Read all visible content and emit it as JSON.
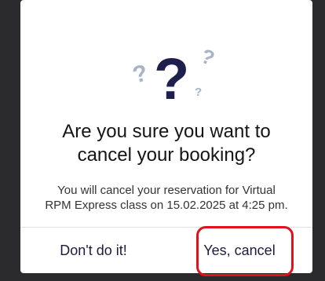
{
  "dialog": {
    "illustration_icon": "question-marks-icon",
    "title_line1": "Are you sure you want to",
    "title_line2": "cancel your booking?",
    "message_line1": "You will cancel your reservation for Virtual",
    "message_line2": "RPM Express class on 15.02.2025 at 4:25 pm.",
    "cancel_button_label": "Don't do it!",
    "confirm_button_label": "Yes, cancel"
  },
  "colors": {
    "dialog_background": "#ffffff",
    "backdrop": "#2b2b2d",
    "primary_text": "#1c1c3c",
    "accent_mark": "#1f1f4d",
    "faded_mark": "#a9b3c6",
    "highlight_outline": "#e0121b"
  }
}
